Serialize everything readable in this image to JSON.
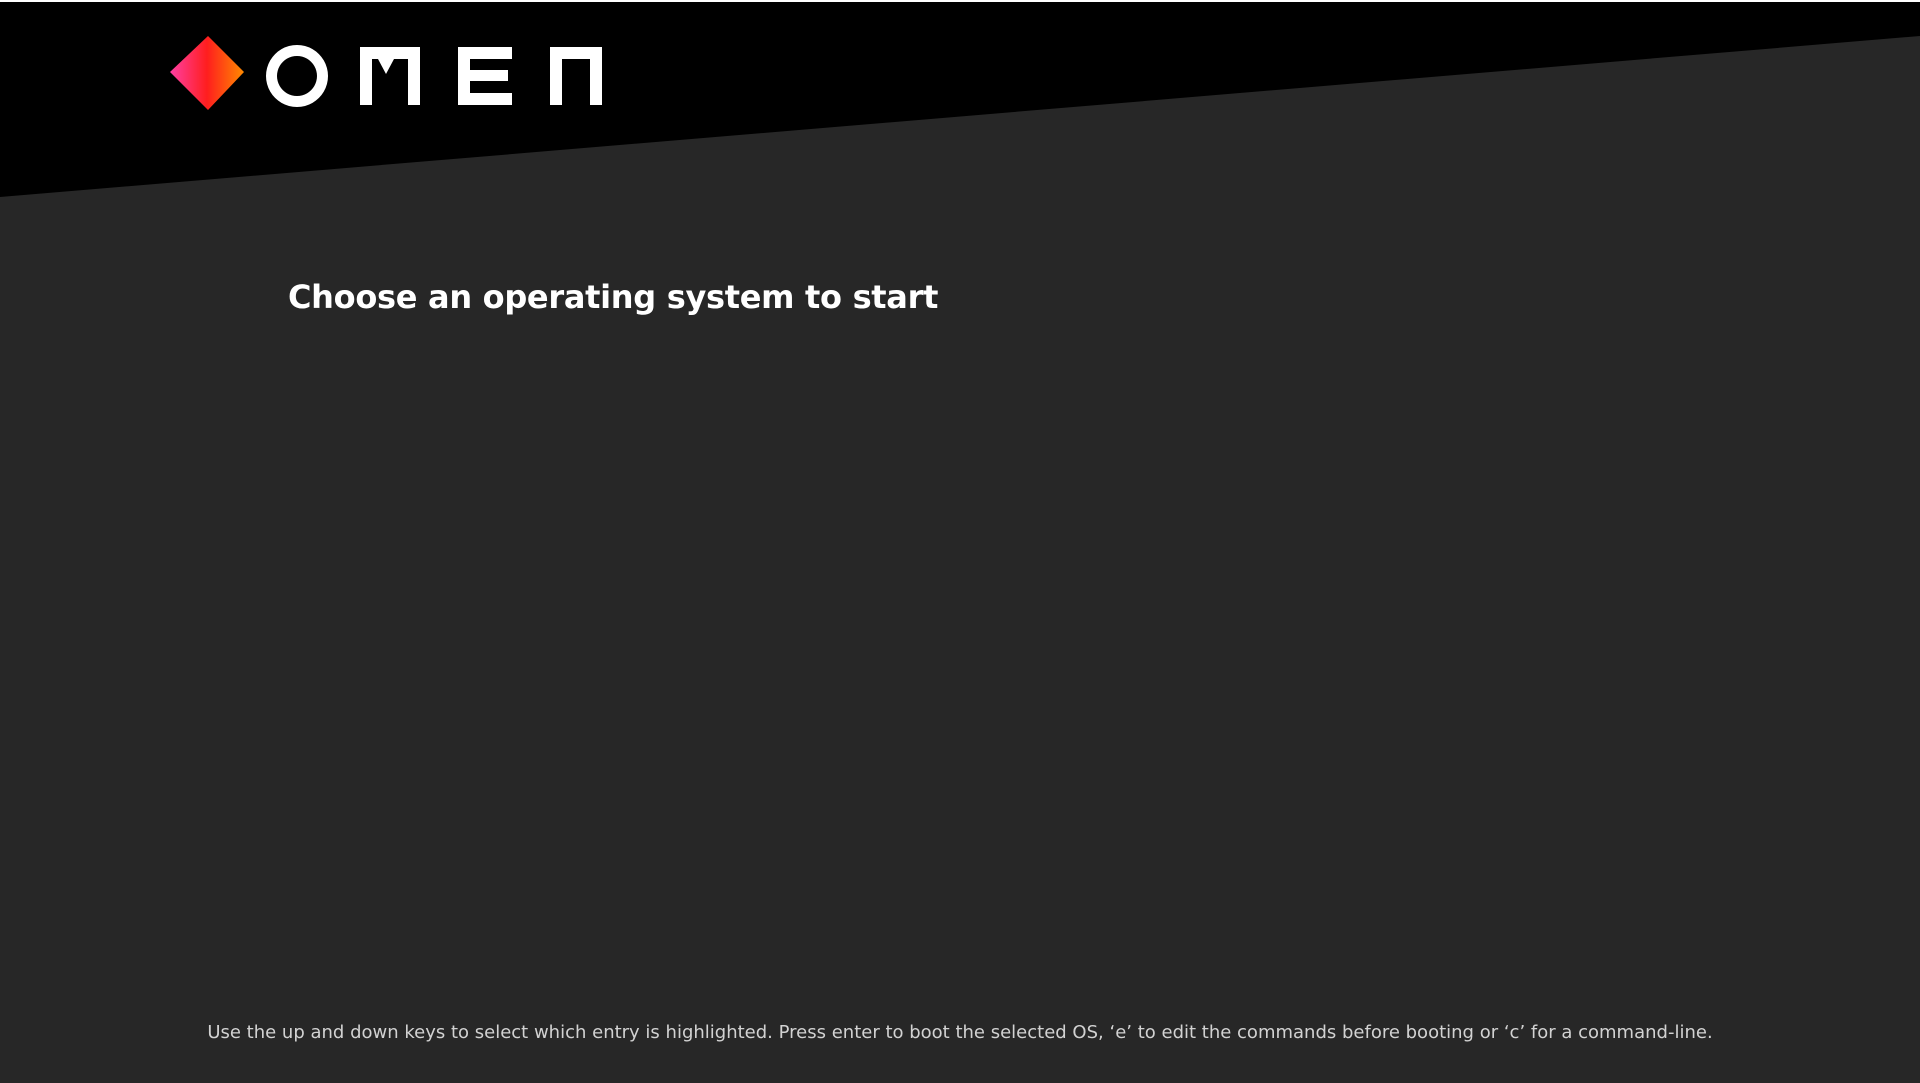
{
  "brand": {
    "name": "OMEN",
    "logo_icon": "omen-diamond-logo",
    "gradient_colors": [
      "#ff3fa4",
      "#ff1e1e",
      "#ff8a00"
    ]
  },
  "colors": {
    "header_band": "#000000",
    "background": "#272727",
    "title_text": "#ffffff",
    "help_text": "#d2d2d2"
  },
  "menu": {
    "title": "Choose an operating system to start",
    "entries": []
  },
  "footer": {
    "help_text": "Use the up and down keys to select which entry is highlighted. Press enter to boot the selected OS, ‘e’ to edit the commands before booting or ‘c’ for a command-line."
  }
}
